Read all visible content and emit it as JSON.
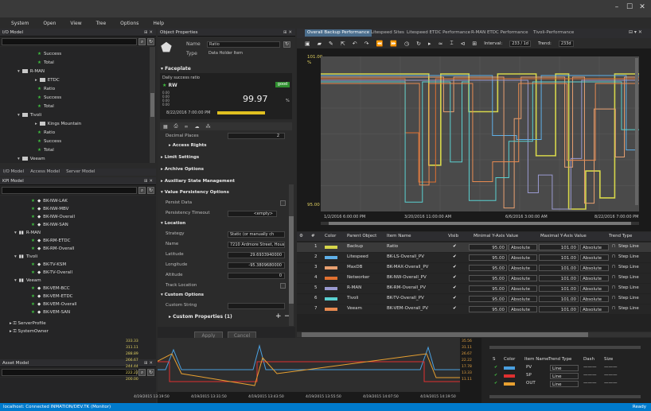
{
  "window": {
    "min_label": "–",
    "max_label": "☐",
    "close_label": "✕"
  },
  "menu": [
    "System",
    "Open",
    "View",
    "Tree",
    "Options",
    "Help"
  ],
  "io_model": {
    "title": "I/O Model",
    "tree": [
      {
        "label": "Success",
        "icon": "green-star",
        "indent": 4
      },
      {
        "label": "Total",
        "icon": "green-star",
        "indent": 4
      },
      {
        "label": "R-MAN",
        "icon": "folder",
        "indent": 3,
        "arrow": "▾"
      },
      {
        "label": "ETDC",
        "icon": "folder",
        "indent": 4,
        "arrow": "▸"
      },
      {
        "label": "Ratio",
        "icon": "green-star",
        "indent": 4
      },
      {
        "label": "Success",
        "icon": "green-star",
        "indent": 4
      },
      {
        "label": "Total",
        "icon": "green-star",
        "indent": 4
      },
      {
        "label": "Tivoli",
        "icon": "folder",
        "indent": 3,
        "arrow": "▾"
      },
      {
        "label": "Kings Mountain",
        "icon": "folder",
        "indent": 4,
        "arrow": "▸"
      },
      {
        "label": "Ratio",
        "icon": "green-star",
        "indent": 4
      },
      {
        "label": "Success",
        "icon": "green-star",
        "indent": 4
      },
      {
        "label": "Total",
        "icon": "green-star",
        "indent": 4
      },
      {
        "label": "Veeam",
        "icon": "folder",
        "indent": 3,
        "arrow": "▾"
      }
    ],
    "tabs": [
      "I/O Model",
      "Access Model",
      "Server Model"
    ]
  },
  "kpi_model": {
    "title": "KPI Model",
    "tree": [
      {
        "label": "BK-NW-LAK",
        "indent": 3,
        "icon": "kpi"
      },
      {
        "label": "BK-NW-MBV",
        "indent": 3,
        "icon": "kpi"
      },
      {
        "label": "BK-NW-Overall",
        "indent": 3,
        "icon": "kpi"
      },
      {
        "label": "BK-NW-SAN",
        "indent": 3,
        "icon": "kpi"
      },
      {
        "label": "R-MAN",
        "indent": 2,
        "icon": "folder",
        "arrow": "▾"
      },
      {
        "label": "BK-RM-ETDC",
        "indent": 3,
        "icon": "kpi"
      },
      {
        "label": "BK-RM-Overall",
        "indent": 3,
        "icon": "kpi"
      },
      {
        "label": "Tivoli",
        "indent": 2,
        "icon": "folder",
        "arrow": "▾"
      },
      {
        "label": "BK-TV-KSM",
        "indent": 3,
        "icon": "kpi"
      },
      {
        "label": "BK-TV-Overall",
        "indent": 3,
        "icon": "kpi"
      },
      {
        "label": "Veeam",
        "indent": 2,
        "icon": "folder",
        "arrow": "▾"
      },
      {
        "label": "BK-VEM-BCC",
        "indent": 3,
        "icon": "kpi"
      },
      {
        "label": "BK-VEM-ETDC",
        "indent": 3,
        "icon": "kpi"
      },
      {
        "label": "BK-VEM-Overall",
        "indent": 3,
        "icon": "kpi"
      },
      {
        "label": "BK-VEM-SAN",
        "indent": 3,
        "icon": "kpi"
      }
    ]
  },
  "server_tree": [
    {
      "label": "ServerProfile"
    },
    {
      "label": "SystemOwner"
    }
  ],
  "asset_model": {
    "title": "Asset Model"
  },
  "object_properties": {
    "title": "Object Properties",
    "name_label": "Name",
    "name_value": "Ratio",
    "type_label": "Type",
    "type_value": "Data Holder Item",
    "faceplate": "Faceplate",
    "daily_label": "Daily success ratio",
    "rw": "RW",
    "good": "good",
    "big_value": "99.97",
    "pct": "%",
    "mini_ticks": [
      "0.00",
      "0.00",
      "0.00",
      "0.00"
    ],
    "timestamp": "8/22/2016 7:00:00 PM",
    "decimal_places": "Decimal Places",
    "decimal_value": "2",
    "access_rights": "Access Rights",
    "limit_settings": "Limit Settings",
    "archive_options": "Archive Options",
    "aux_state": "Auxiliary State Management",
    "value_persistency": "Value Persistency Options",
    "persist_data": "Persist Data",
    "persistency_timeout": "Persistency Timeout",
    "persistency_value": "<empty>",
    "location": "Location",
    "strategy": "Strategy",
    "strategy_value": "Static (or manually ch",
    "loc_name": "Name",
    "loc_name_value": "7210 Ardmore Street, Hous",
    "latitude": "Latitude",
    "latitude_value": "29.6933940000",
    "longitude": "Longitude",
    "longitude_value": "-95.3809680000",
    "altitude": "Altitude",
    "altitude_value": "0",
    "track_location": "Track Location",
    "custom_options": "Custom Options",
    "custom_string": "Custom String",
    "custom_properties": "Custom Properties (1)",
    "apply": "Apply",
    "cancel": "Cancel"
  },
  "trend": {
    "tabs": [
      "Overall Backup Performance",
      "Litespeed Sites",
      "Litespeed ETDC Performance",
      "R-MAN ETDC Performance",
      "Tivoli-Performance"
    ],
    "interval_label": "Interval:",
    "interval_value": "233 / 1d",
    "trend_label": "Trend:",
    "trend_value": "233d",
    "y_top": "101.00",
    "y_top_unit": "%",
    "y_bottom": "95.00",
    "x_labels": [
      "1/2/2016 6:00:00 PM",
      "3/20/2016 11:00:00 AM",
      "6/6/2016 3:00:00 AM",
      "8/22/2016 7:00:00 PM"
    ]
  },
  "grid": {
    "headers": [
      "#",
      "Color",
      "Parent Object",
      "Item Name",
      "Visib",
      "Minimal Y-Axis Value",
      "Maximal Y-Axis Value",
      "Trend Type"
    ],
    "rows": [
      {
        "n": "1",
        "color": "#d6d64a",
        "parent": "Backup",
        "item": "Ratio",
        "min": "95.00",
        "max": "101.00",
        "mode": "Absolute",
        "type": "Step Line"
      },
      {
        "n": "2",
        "color": "#5fb0e8",
        "parent": "Litespeed",
        "item": "BK-LS-Overall_PV",
        "min": "95.00",
        "max": "101.00",
        "mode": "Absolute",
        "type": "Step Line"
      },
      {
        "n": "3",
        "color": "#e8a070",
        "parent": "MaxDB",
        "item": "BK-MAX-Overall_PV",
        "min": "95.00",
        "max": "101.00",
        "mode": "Absolute",
        "type": "Step Line"
      },
      {
        "n": "4",
        "color": "#e07030",
        "parent": "Networker",
        "item": "BK-NW-Overall_PV",
        "min": "95.00",
        "max": "101.00",
        "mode": "Absolute",
        "type": "Step Line"
      },
      {
        "n": "5",
        "color": "#9a9ad0",
        "parent": "R-MAN",
        "item": "BK-RM-Overall_PV",
        "min": "95.00",
        "max": "101.00",
        "mode": "Absolute",
        "type": "Step Line"
      },
      {
        "n": "6",
        "color": "#5ad0d0",
        "parent": "Tivoli",
        "item": "BK-TV-Overall_PV",
        "min": "95.00",
        "max": "101.00",
        "mode": "Absolute",
        "type": "Step Line"
      },
      {
        "n": "7",
        "color": "#e88a50",
        "parent": "Veeam",
        "item": "BK-VEM-Overall_PV",
        "min": "95.00",
        "max": "101.00",
        "mode": "Absolute",
        "type": "Step Line"
      }
    ]
  },
  "bottom_trend": {
    "y_left": [
      "333.33",
      "311.11",
      "288.89",
      "266.67",
      "244.44",
      "222.22",
      "200.00"
    ],
    "y_right": [
      "35.56",
      "31.11",
      "26.67",
      "22.22",
      "17.78",
      "13.33",
      "11.11"
    ],
    "x_labels": [
      "4/19/2015 13:19:50",
      "4/19/2015 13:31:50",
      "4/19/2015 13:43:50",
      "4/19/2015 13:55:50",
      "4/19/2015 14:07:50",
      "4/19/2015 14:19:50"
    ]
  },
  "pid_grid": {
    "headers": [
      "S",
      "Color",
      "Item Name",
      "Trend Type",
      "Dash",
      "Size"
    ],
    "rows": [
      {
        "color": "#4aa0e0",
        "item": "PV",
        "type": "Line"
      },
      {
        "color": "#e03030",
        "item": "SP",
        "type": "Line"
      },
      {
        "color": "#e8a030",
        "item": "OUT",
        "type": "Line"
      }
    ]
  },
  "status": {
    "text": "localhost: Connected   INMATION/DEV.TK (Monitor)",
    "right": "Ready"
  }
}
